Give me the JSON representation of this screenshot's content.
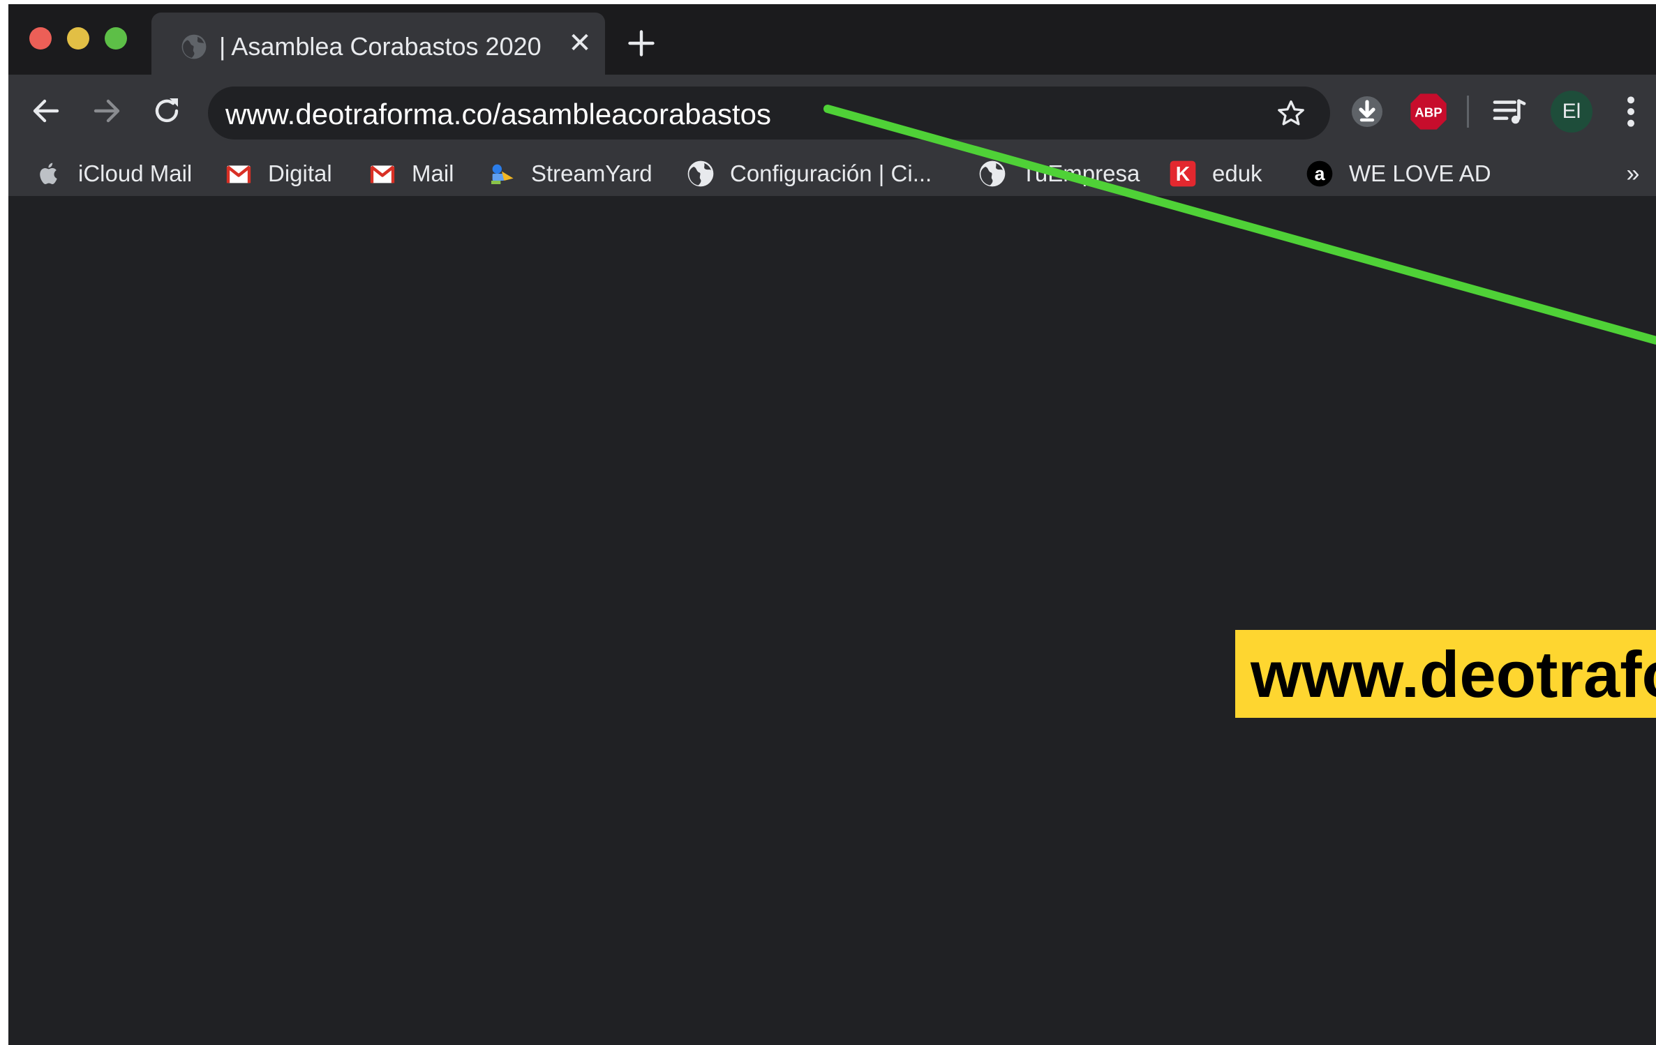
{
  "window": {
    "tab_title": "| Asamblea Corabastos 2020",
    "tab_close_glyph": "✕"
  },
  "toolbar": {
    "url": "www.deotraforma.co/asambleacorabastos",
    "profile_initials": "El"
  },
  "bookmarks": [
    {
      "label": "iCloud Mail",
      "icon": "apple-icon"
    },
    {
      "label": "Digital",
      "icon": "gmail-icon"
    },
    {
      "label": "Mail",
      "icon": "gmail-icon"
    },
    {
      "label": "StreamYard",
      "icon": "streamyard-icon"
    },
    {
      "label": "Configuración | Ci...",
      "icon": "globe-icon"
    },
    {
      "label": "TuEmpresa",
      "icon": "globe-icon"
    },
    {
      "label": "eduk",
      "icon": "eduk-icon"
    },
    {
      "label": "WE LOVE AD",
      "icon": "welovead-icon"
    }
  ],
  "bookmarks_overflow_glyph": "»",
  "annotation": {
    "callout_text": "www.deotraforma.co/asambleacorabastos",
    "arrow_color": "#4fd137",
    "callout_color": "#fed630"
  },
  "icons": {
    "abp_label": "ABP",
    "eduk_letter": "K",
    "welovead_letter": "a"
  },
  "colors": {
    "page_bg": "#202124",
    "toolbar_bg": "#35363a",
    "tabbar_bg": "#1b1b1d"
  }
}
